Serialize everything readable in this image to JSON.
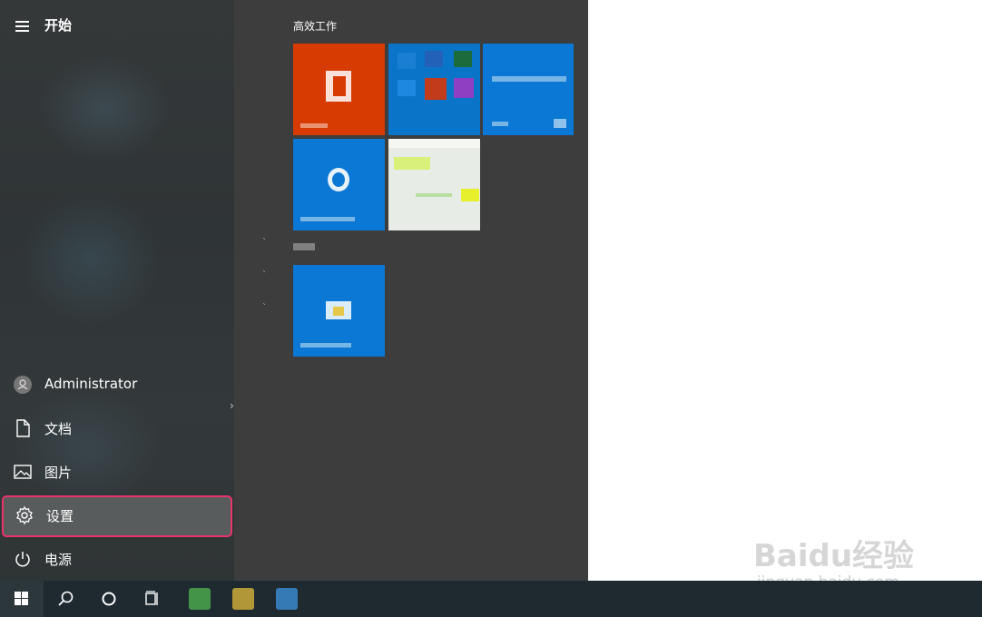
{
  "start_menu": {
    "title": "开始",
    "user": {
      "name": "Administrator"
    },
    "items": [
      {
        "id": "documents",
        "label": "文档"
      },
      {
        "id": "pictures",
        "label": "图片"
      },
      {
        "id": "settings",
        "label": "设置"
      },
      {
        "id": "power",
        "label": "电源"
      }
    ],
    "selected_item": "settings",
    "tile_group_title": "高效工作"
  },
  "colors": {
    "selection_border": "#e8336b",
    "office_tile": "#d83b01",
    "app_tile_blue": "#0a78d4"
  },
  "taskbar": {
    "icons": [
      "windows-start-icon",
      "search-icon",
      "cortana-icon",
      "task-view-icon"
    ]
  },
  "watermark": {
    "brand": "Baidu",
    "suffix": "经验",
    "url": "jingyan.baidu.com"
  }
}
